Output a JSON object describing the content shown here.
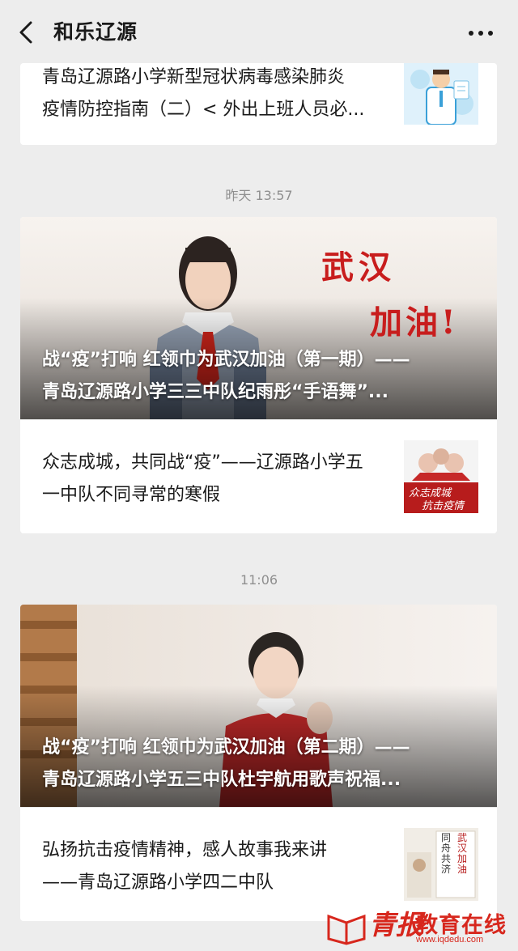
{
  "header": {
    "title": "和乐辽源",
    "back_icon": "chevron-left-icon",
    "more_icon": "ellipsis-icon"
  },
  "group1": {
    "item": {
      "title_line1": "青岛辽源路小学新型冠状病毒感染肺炎",
      "title_line2": "疫情防控指南（二）< 外出上班人员必..."
    }
  },
  "group2": {
    "time": "昨天 13:57",
    "cover": {
      "title_line1": "战“疫”打响 红领巾为武汉加油（第一期）——",
      "title_line2": "青岛辽源路小学三三中队纪雨彤“手语舞”...",
      "overlay_line1": "武汉",
      "overlay_line2": "加油!"
    },
    "item": {
      "title_line1": "众志成城，共同战“疫”——辽源路小学五",
      "title_line2": "一中队不同寻常的寒假",
      "thumb_text1": "众志成城",
      "thumb_text2": "抗击疫情"
    }
  },
  "group3": {
    "time": "11:06",
    "cover": {
      "title_line1": "战“疫”打响 红领巾为武汉加油（第二期）——",
      "title_line2": "青岛辽源路小学五三中队杜宇航用歌声祝福..."
    },
    "item": {
      "title_line1": "弘扬抗击疫情精神，感人故事我来讲",
      "title_line2": "——青岛辽源路小学四二中队",
      "thumb_text1": "同舟共济",
      "thumb_text2": "武汉加油"
    }
  },
  "watermark": {
    "brand": "教育在线",
    "logo_text": "青报",
    "url": "www.iqdedu.com"
  },
  "colors": {
    "background": "#ededed",
    "card": "#ffffff",
    "meta_text": "#8f8f8f",
    "watermark": "#d7271d"
  }
}
